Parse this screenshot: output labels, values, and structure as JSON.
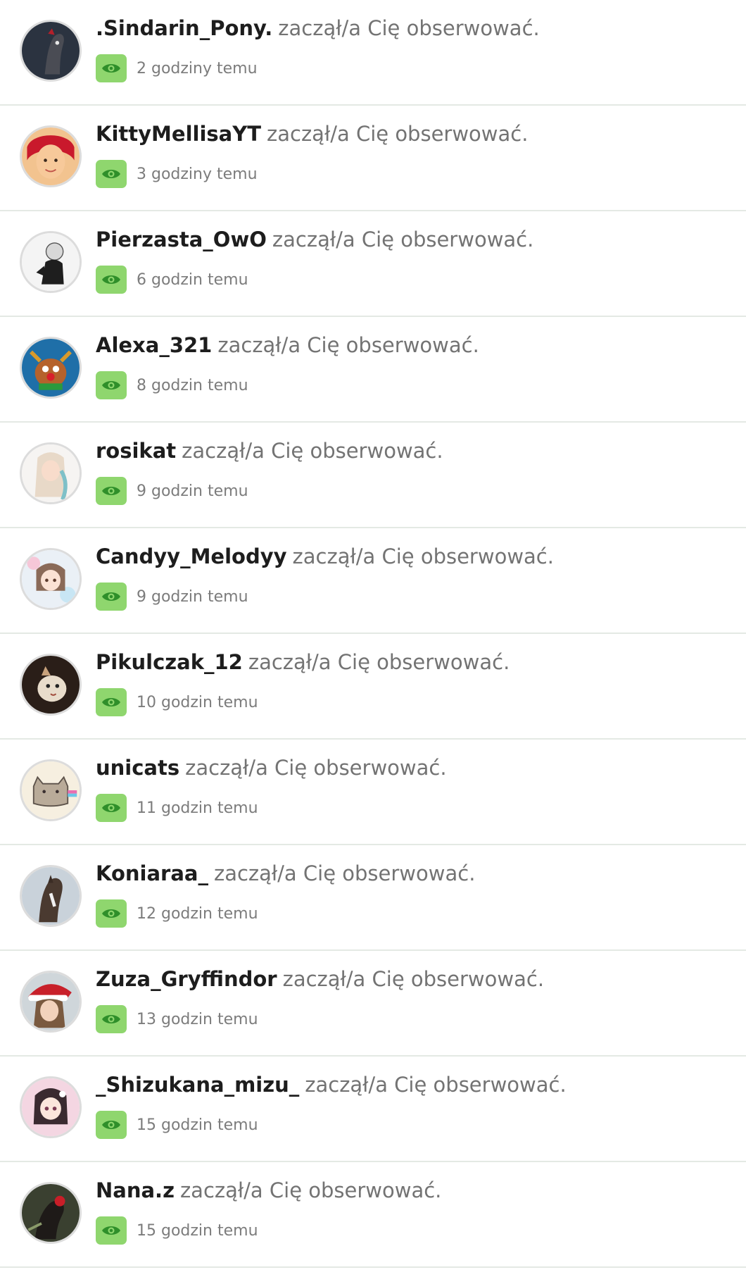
{
  "notifications": [
    {
      "username": ".Sindarin_Pony.",
      "action": "zaczął/a Cię obserwować.",
      "time": "2 godziny temu",
      "avatar_icon": "horse-avatar-icon"
    },
    {
      "username": "KittyMellisaYT",
      "action": "zaczął/a Cię obserwować.",
      "time": "3 godziny temu",
      "avatar_icon": "girl-avatar-icon"
    },
    {
      "username": "Pierzasta_OwO",
      "action": "zaczął/a Cię obserwować.",
      "time": "6 godzin temu",
      "avatar_icon": "sketch-avatar-icon"
    },
    {
      "username": "Alexa_321",
      "action": "zaczął/a Cię obserwować.",
      "time": "8 godzin temu",
      "avatar_icon": "reindeer-avatar-icon"
    },
    {
      "username": "rosikat",
      "action": "zaczął/a Cię obserwować.",
      "time": "9 godzin temu",
      "avatar_icon": "anime-girl-avatar-icon"
    },
    {
      "username": "Candyy_Melodyy",
      "action": "zaczął/a Cię obserwować.",
      "time": "9 godzin temu",
      "avatar_icon": "anime-girl-avatar-icon"
    },
    {
      "username": "Pikulczak_12",
      "action": "zaczął/a Cię obserwować.",
      "time": "10 godzin temu",
      "avatar_icon": "cat-avatar-icon"
    },
    {
      "username": "unicats",
      "action": "zaczął/a Cię obserwować.",
      "time": "11 godzin temu",
      "avatar_icon": "pusheen-avatar-icon"
    },
    {
      "username": "Koniaraa_",
      "action": "zaczął/a Cię obserwować.",
      "time": "12 godzin temu",
      "avatar_icon": "horse-avatar-icon"
    },
    {
      "username": "Zuza_Gryffindor",
      "action": "zaczął/a Cię obserwować.",
      "time": "13 godzin temu",
      "avatar_icon": "santa-hat-girl-avatar-icon"
    },
    {
      "username": "_Shizukana_mizu_",
      "action": "zaczął/a Cię obserwować.",
      "time": "15 godzin temu",
      "avatar_icon": "anime-girl-avatar-icon"
    },
    {
      "username": "Nana.z",
      "action": "zaczął/a Cię obserwować.",
      "time": "15 godzin temu",
      "avatar_icon": "horse-avatar-icon"
    }
  ],
  "colors": {
    "eye_badge": "#8fd66e",
    "eye_icon": "#2f8f2a",
    "divider": "#e4e9e4"
  }
}
